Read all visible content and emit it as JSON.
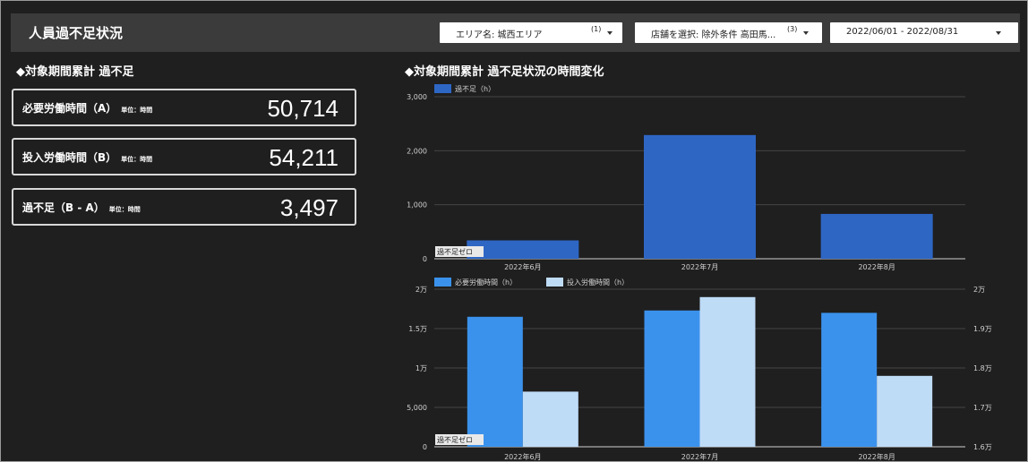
{
  "header": {
    "title": "人員過不足状況"
  },
  "filters": [
    {
      "label": "エリア名: 城西エリア",
      "count": "(1)"
    },
    {
      "label": "店舗を選択: 除外条件 高田馬...",
      "count": "(3)"
    },
    {
      "label": "2022/06/01 - 2022/08/31",
      "count": ""
    }
  ],
  "left_section": {
    "title": "◆対象期間累計 過不足"
  },
  "kpis": [
    {
      "name": "必要労働時間（A）",
      "unit": "単位：時間",
      "value": "50,714"
    },
    {
      "name": "投入労働時間（B）",
      "unit": "単位：時間",
      "value": "54,211"
    },
    {
      "name": "過不足（B - A）",
      "unit": "単位：時間",
      "value": "3,497"
    }
  ],
  "right_section": {
    "title": "◆対象期間累計 過不足状況の時間変化"
  },
  "colors": {
    "shortage": "#2e66c4",
    "required": "#3b92ec",
    "input": "#bfdcf7"
  },
  "chart_data": [
    {
      "type": "bar",
      "categories": [
        "2022年6月",
        "2022年7月",
        "2022年8月"
      ],
      "series": [
        {
          "name": "過不足（h）",
          "values": [
            340,
            2290,
            830
          ]
        }
      ],
      "ylim": [
        0,
        3000
      ],
      "yticks": [
        "0",
        "1,000",
        "2,000",
        "3,000"
      ],
      "reference_line": {
        "label": "過不足ゼロ",
        "value": 0
      },
      "legend": "top-left",
      "grid": true
    },
    {
      "type": "bar",
      "categories": [
        "2022年6月",
        "2022年7月",
        "2022年8月"
      ],
      "series": [
        {
          "name": "必要労働時間（h）",
          "axis": "left",
          "values": [
            16500,
            17300,
            17000
          ]
        },
        {
          "name": "投入労働時間（h）",
          "axis": "right",
          "values": [
            17400,
            19800,
            17800
          ]
        }
      ],
      "ylim_left": [
        0,
        20000
      ],
      "yticks_left": [
        "0",
        "5,000",
        "1万",
        "1.5万",
        "2万"
      ],
      "ylim_right": [
        16000,
        20000
      ],
      "yticks_right": [
        "1.6万",
        "1.7万",
        "1.8万",
        "1.9万",
        "2万"
      ],
      "reference_line": {
        "label": "過不足ゼロ",
        "value": 0
      },
      "legend": "top-left",
      "grid": true
    }
  ]
}
